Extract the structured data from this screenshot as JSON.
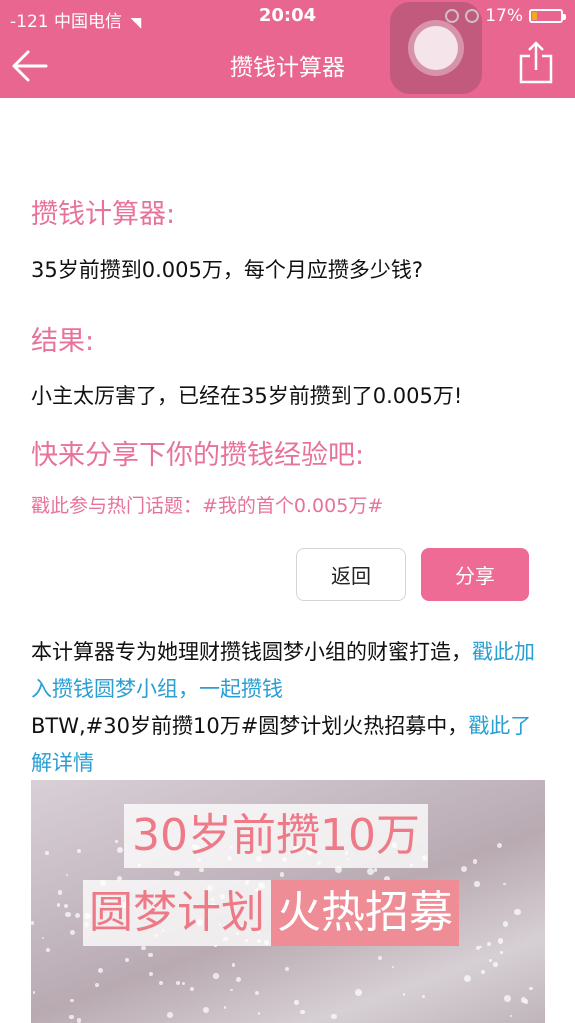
{
  "status": {
    "carrier": "-121 中国电信",
    "time": "20:04",
    "battery": "17%",
    "battery_level": 0.17
  },
  "nav": {
    "title": "攒钱计算器"
  },
  "content": {
    "heading": "攒钱计算器:",
    "question": "35岁前攒到0.005万，每个月应攒多少钱?",
    "result_heading": "结果:",
    "result_text": "小主太厉害了，已经在35岁前攒到了0.005万!",
    "share_prompt": "快来分享下你的攒钱经验吧:",
    "topic_link": "戳此参与热门话题：#我的首个0.005万#"
  },
  "buttons": {
    "back": "返回",
    "share": "分享"
  },
  "description": {
    "text1": "本计算器专为她理财攒钱圆梦小组的财蜜打造，",
    "link1": "戳此加入攒钱圆梦小组，一起攒钱",
    "text2": "BTW,#30岁前攒10万#圆梦计划火热招募中，",
    "link2": "戳此了解详情"
  },
  "banner": {
    "line1": "30岁前攒10万",
    "line2_part1": "圆梦计划",
    "line2_part2": "火热招募"
  },
  "colors": {
    "accent": "#e8668f",
    "link": "#2a9fd3"
  }
}
